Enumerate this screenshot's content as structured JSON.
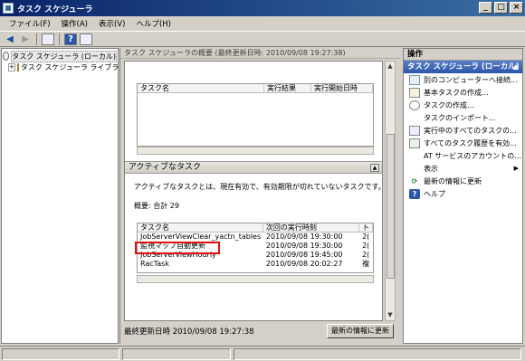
{
  "window": {
    "title": "タスク スケジューラ",
    "buttons": [
      "_",
      "□",
      "×"
    ]
  },
  "menu": [
    "ファイル(F)",
    "操作(A)",
    "表示(V)",
    "ヘルプ(H)"
  ],
  "toolbar": {
    "icons": [
      "back-arrow-icon",
      "forward-arrow-icon",
      "show-hide-tree-icon",
      "help-icon",
      "show-action-pane-icon"
    ]
  },
  "tree": {
    "root": "タスク スケジューラ (ローカル)",
    "library": "タスク スケジューラ ライブラリ"
  },
  "center": {
    "header": "タスク スケジューラの概要 (最終更新日時: 2010/09/08 19:27:38)",
    "status_table": {
      "columns": [
        "タスク名",
        "実行結果",
        "実行開始日時"
      ]
    },
    "active": {
      "title": "アクティブなタスク",
      "description": "アクティブなタスクとは、現在有効で、有効期限が切れていないタスクです。",
      "summary": "概要: 合計 29",
      "columns": [
        "タスク名",
        "次回の実行時刻",
        "ト"
      ],
      "rows": [
        {
          "name": "JobServerViewClear_yactn_tables",
          "next": "2010/09/08 19:30:00",
          "t": "2("
        },
        {
          "name": "監視マップ自動更新",
          "next": "2010/09/08 19:30:00",
          "t": "2("
        },
        {
          "name": "JobServerViewHourly",
          "next": "2010/09/08 19:45:00",
          "t": "2("
        },
        {
          "name": "RacTask",
          "next": "2010/09/08 20:02:27",
          "t": "複"
        }
      ]
    },
    "last_updated": "最終更新日時 2010/09/08 19:27:38",
    "refresh_label": "最新の情報に更新"
  },
  "actions": {
    "title": "操作",
    "group": "タスク スケジューラ (ローカル)",
    "items": [
      {
        "label": "別のコンピューターへ接続...",
        "icon": "connect-icon"
      },
      {
        "label": "基本タスクの作成...",
        "icon": "basic-task-icon"
      },
      {
        "label": "タスクの作成...",
        "icon": "create-task-icon"
      },
      {
        "label": "タスクのインポート...",
        "icon": "import-icon"
      },
      {
        "label": "実行中のすべてのタスクの...",
        "icon": "running-tasks-icon"
      },
      {
        "label": "すべてのタスク履歴を有効...",
        "icon": "history-icon"
      },
      {
        "label": "AT サービスのアカウントの...",
        "icon": "at-service-icon"
      },
      {
        "label": "表示",
        "icon": "view-icon"
      },
      {
        "label": "最新の情報に更新",
        "icon": "refresh-icon"
      },
      {
        "label": "ヘルプ",
        "icon": "help-icon"
      }
    ]
  },
  "colors": {
    "highlight": "#e01010",
    "title_bar": "#0a246a",
    "action_group": "#2c56a8"
  }
}
